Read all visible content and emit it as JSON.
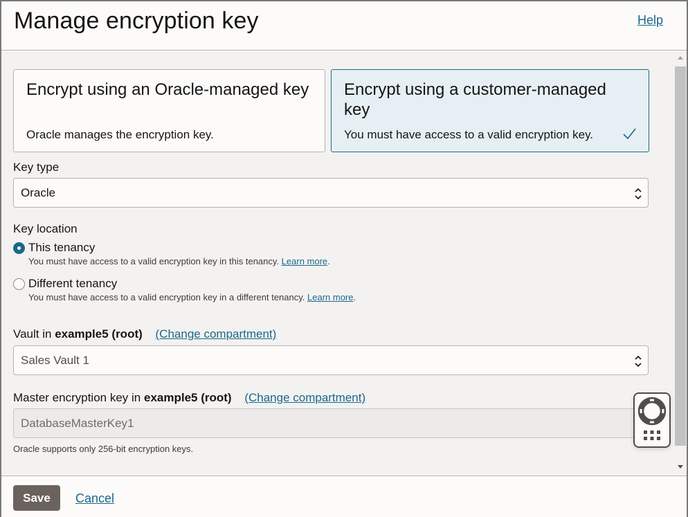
{
  "header": {
    "title": "Manage encryption key",
    "help_label": "Help"
  },
  "options": [
    {
      "title": "Encrypt using an Oracle-managed key",
      "description": "Oracle manages the encryption key.",
      "selected": false
    },
    {
      "title": "Encrypt using a customer-managed key",
      "description": "You must have access to a valid encryption key.",
      "selected": true
    }
  ],
  "key_type": {
    "label": "Key type",
    "value": "Oracle"
  },
  "key_location": {
    "label": "Key location",
    "choices": [
      {
        "label": "This tenancy",
        "help": "You must have access to a valid encryption key in this tenancy.",
        "link": "Learn more",
        "checked": true
      },
      {
        "label": "Different tenancy",
        "help": "You must have access to a valid encryption key in a different tenancy.",
        "link": "Learn more",
        "checked": false
      }
    ]
  },
  "vault": {
    "label_prefix": "Vault in",
    "compartment": "example5 (root)",
    "change_label": "(Change compartment)",
    "value": "Sales Vault 1"
  },
  "master_key": {
    "label_prefix": "Master encryption key in",
    "compartment": "example5 (root)",
    "change_label": "(Change compartment)",
    "value": "DatabaseMasterKey1",
    "note": "Oracle supports only 256-bit encryption keys."
  },
  "footer": {
    "save_label": "Save",
    "cancel_label": "Cancel"
  },
  "colors": {
    "accent": "#1c6789",
    "selected_card_bg": "#e6f0f4",
    "save_button": "#6b625d"
  }
}
